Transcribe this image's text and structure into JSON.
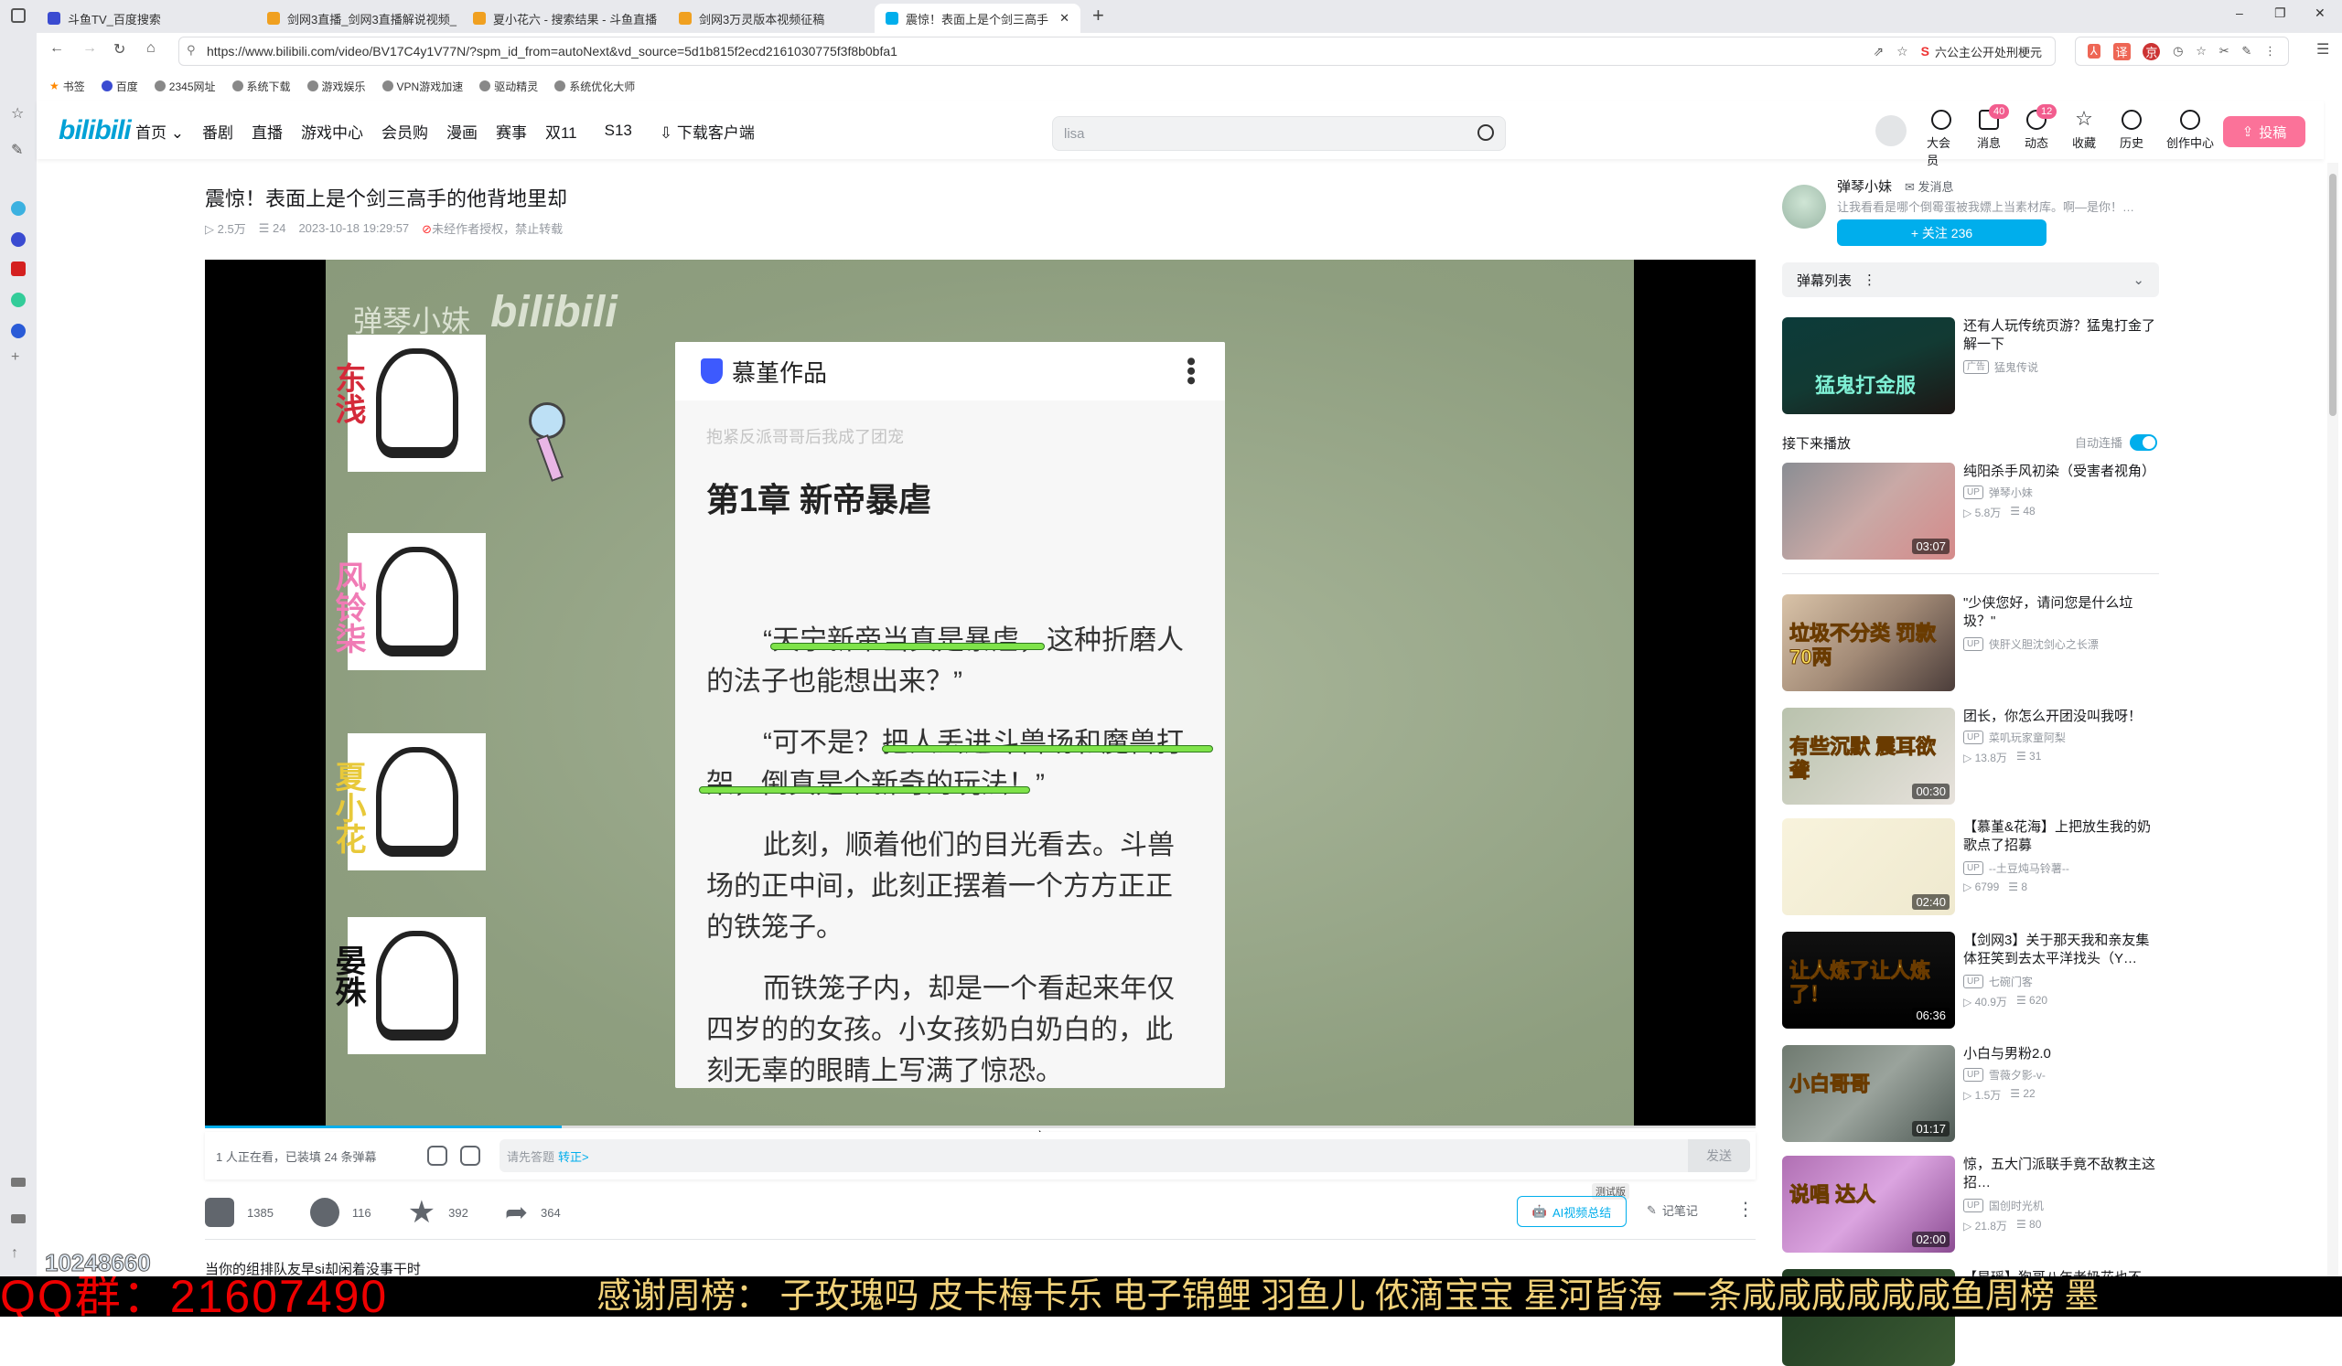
{
  "browser": {
    "tabs": [
      {
        "label": "斗鱼TV_百度搜索",
        "icon": "baidu-paw-icon",
        "color": "#3a4bd1"
      },
      {
        "label": "剑网3直播_剑网3直播解说视频_",
        "icon": "douyu-icon",
        "color": "#f0a020"
      },
      {
        "label": "夏小花六 - 搜索结果 - 斗鱼直播",
        "icon": "douyu-icon",
        "color": "#f0a020"
      },
      {
        "label": "剑网3万灵版本视频征稿",
        "icon": "douyu-icon",
        "color": "#f0a020"
      },
      {
        "label": "震惊！表面上是个剑三高手",
        "icon": "bilibili-tv-icon",
        "color": "#00aeec",
        "active": true
      }
    ],
    "new_tab": "+",
    "url": "https://www.bilibili.com/video/BV17C4y1V77N/?spm_id_from=autoNext&vd_source=5d1b815f2ecd2161030775f3f8b0bfa1",
    "search_engine_hint": "六公主公开处刑梗元",
    "bookmarks": [
      "书签",
      "百度",
      "2345网址",
      "系统下载",
      "游戏娱乐",
      "VPN游戏加速",
      "驱动精灵",
      "系统优化大师"
    ],
    "window_controls": {
      "minimize": "–",
      "restore": "❐",
      "close": "✕"
    }
  },
  "header": {
    "logo": "bilibili",
    "nav": [
      "首页",
      "番剧",
      "直播",
      "游戏中心",
      "会员购",
      "漫画",
      "赛事",
      "双11",
      "S13",
      "下载客户端"
    ],
    "search_placeholder": "lisa",
    "icons": [
      {
        "label": "大会员",
        "icon": "vip-icon"
      },
      {
        "label": "消息",
        "icon": "message-icon",
        "badge": "40"
      },
      {
        "label": "动态",
        "icon": "dynamic-icon",
        "badge": "12"
      },
      {
        "label": "收藏",
        "icon": "favorite-icon"
      },
      {
        "label": "历史",
        "icon": "history-icon"
      },
      {
        "label": "创作中心",
        "icon": "creator-icon"
      }
    ],
    "upload": "投稿",
    "accent": "#fb7299",
    "brand": "#00aeec"
  },
  "video": {
    "title": "震惊！表面上是个剑三高手的他背地里却",
    "views": "2.5万",
    "danmaku_count": "24",
    "date": "2023-10-18 19:29:57",
    "copyright": "未经作者授权，禁止转载",
    "progress": 0.23,
    "frame": {
      "watermark_name": "弹琴小妹",
      "watermark_logo": "bilibili",
      "characters": [
        {
          "name": "东浅",
          "color": "#d42a3a"
        },
        {
          "name": "风铃柒",
          "color": "#f07bb5"
        },
        {
          "name": "夏小花",
          "color": "#e8c93a"
        },
        {
          "name": "晏殊",
          "color": "#111111"
        }
      ],
      "card_app": "慕堇作品",
      "card_book": "抱紧反派哥哥后我成了团宠",
      "card_chapter": "第1章 新帝暴虐",
      "paragraphs": [
        "“天宁新帝当真是暴虐，这种折磨人的法子也能想出来？”",
        "“可不是？把人丢进斗兽场和魔兽打架，倒真是个新奇的玩法！”",
        "此刻，顺着他们的目光看去。斗兽场的正中间，此刻正摆着一个方方正正的铁笼子。",
        "而铁笼子内，却是一个看起来年仅四岁的的女孩。小女孩奶白奶白的，此刻无辜的眼睛上写满了惊恐。"
      ]
    }
  },
  "danmaku_bar": {
    "status": "1 人正在看，已装填 24 条弹幕",
    "placeholder": "请先答题",
    "link": "转正>",
    "send": "发送"
  },
  "actions": {
    "like": "1385",
    "coin": "116",
    "favorite": "392",
    "share": "364",
    "ai_summary": "AI视频总结",
    "ai_beta": "测试版",
    "notes": "记笔记"
  },
  "description": "当你的组排队友早si却闲着没事干时",
  "overlay": {
    "uid": "10248660",
    "qq": "QQ群：21607490",
    "thanks": "感谢周榜：   子玫瑰吗 皮卡梅卡乐 电子锦鲤 羽鱼儿 侬滴宝宝 星河皆海 一条咸咸咸咸咸咸鱼周榜  墨"
  },
  "uploader": {
    "name": "弹琴小妹",
    "message": "发消息",
    "signature": "让我看看是哪个倒霉蛋被我嫖上当素材库。啊—是你！…",
    "follow": "+ 关注 236"
  },
  "sidebar": {
    "danmaku_list": "弹幕列表",
    "ad": {
      "title": "还有人玩传统页游？猛鬼打金了解一下",
      "tag": "广告",
      "source": "猛鬼传说",
      "thumb_text": "猛鬼打金服"
    },
    "next_label": "接下来播放",
    "autoplay": "自动连播",
    "autoplay_on": true,
    "videos": [
      {
        "title": "纯阳杀手风初染（受害者视角）",
        "up": "弹琴小妹",
        "views": "5.8万",
        "danmaku": "48",
        "duration": "03:07",
        "thumb_text": ""
      },
      {
        "title": "\"少侠您好，请问您是什么垃圾？\"",
        "up": "侠肝义胆沈剑心之长漂",
        "views": "",
        "danmaku": "",
        "duration": "",
        "thumb_text": "垃圾不分类 罚款70两"
      },
      {
        "title": "团长，你怎么开团没叫我呀！",
        "up": "菜叽玩家童阿梨",
        "views": "13.8万",
        "danmaku": "31",
        "duration": "00:30",
        "thumb_text": "有些沉默 震耳欲聋"
      },
      {
        "title": "【慕堇&花海】上把放生我的奶歌点了招募",
        "up": "--土豆炖马铃薯--",
        "views": "6799",
        "danmaku": "8",
        "duration": "02:40",
        "thumb_text": ""
      },
      {
        "title": "【剑网3】关于那天我和亲友集体狂笑到去太平洋找头（Y…",
        "up": "七碗门客",
        "views": "40.9万",
        "danmaku": "620",
        "duration": "06:36",
        "thumb_text": "让人炼了让人炼了！"
      },
      {
        "title": "小白与男粉2.0",
        "up": "雪薇夕影-v-",
        "views": "1.5万",
        "danmaku": "22",
        "duration": "01:17",
        "thumb_text": "小白哥哥"
      },
      {
        "title": "惊，五大门派联手竟不敌教主这招…",
        "up": "国创时光机",
        "views": "21.8万",
        "danmaku": "80",
        "duration": "02:00",
        "thumb_text": "说唱 达人"
      },
      {
        "title": "【星瑶】狗哥八年老奶花也不",
        "up": "",
        "views": "",
        "danmaku": "",
        "duration": "",
        "thumb_text": ""
      }
    ]
  }
}
